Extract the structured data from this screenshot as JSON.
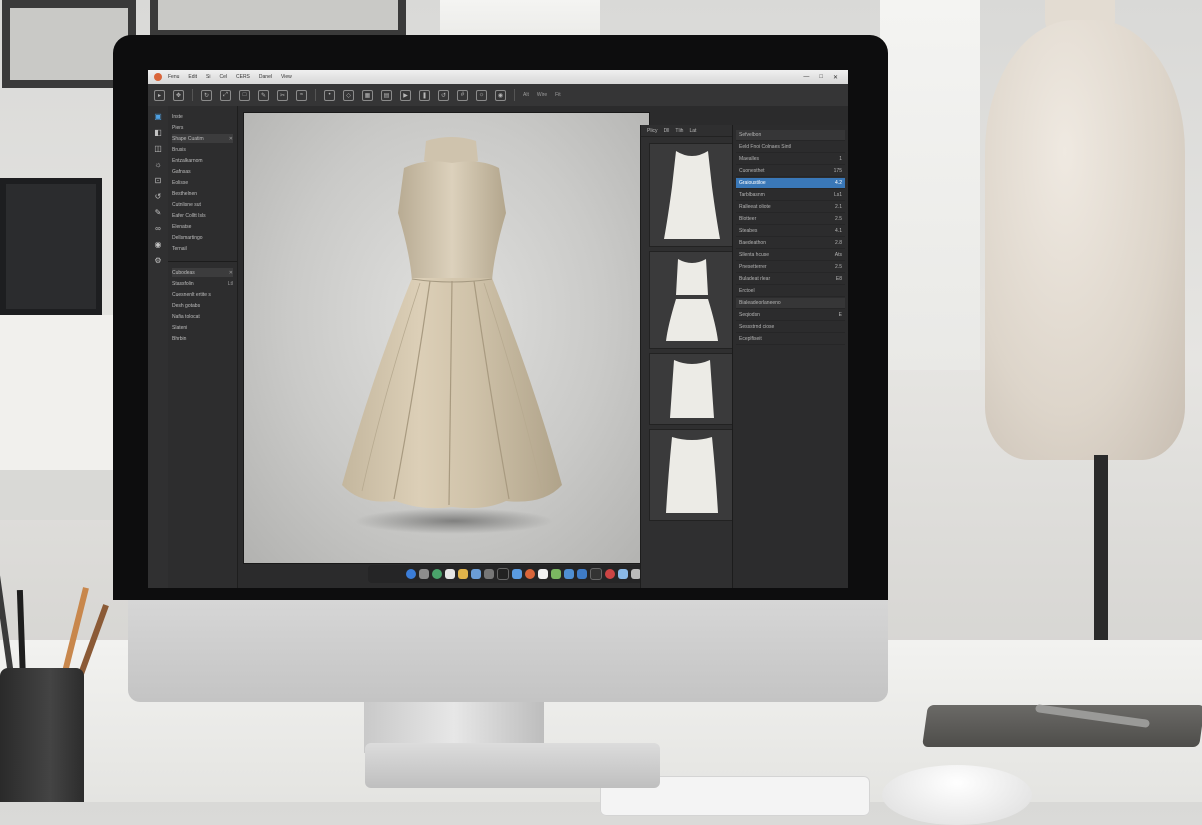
{
  "app": {
    "menu": [
      "Fenu",
      "Edit",
      "Si",
      "Cel",
      "CERS",
      "Danel",
      "View"
    ],
    "window_controls": [
      "—",
      "□",
      "✕"
    ]
  },
  "toolbar": {
    "labels": [
      "Alt",
      "Wire",
      "Fit"
    ]
  },
  "left_panel": {
    "rows": [
      {
        "label": "Inste",
        "meta": ""
      },
      {
        "label": "Piers",
        "meta": ""
      },
      {
        "label": "Shape Cuatim",
        "meta": "✕"
      },
      {
        "label": "Brusis",
        "meta": ""
      },
      {
        "label": "Entzalkarnom",
        "meta": ""
      },
      {
        "label": "Gafnsas",
        "meta": ""
      },
      {
        "label": "Eolisse",
        "meta": ""
      },
      {
        "label": "Besthelnen",
        "meta": ""
      },
      {
        "label": "Cutnlisne sut",
        "meta": ""
      },
      {
        "label": "Eafer Colltt Isls",
        "meta": ""
      },
      {
        "label": "Elenatse",
        "meta": ""
      },
      {
        "label": "Dellsmartingo",
        "meta": ""
      },
      {
        "label": "Ternail",
        "meta": ""
      }
    ],
    "sub_rows": [
      {
        "label": "Cubodeas",
        "meta": "✕"
      },
      {
        "label": "Stassfolin",
        "meta": "Ltl"
      },
      {
        "label": "Cuesnenlt ertite s",
        "meta": ""
      },
      {
        "label": "Desh gotabs",
        "meta": ""
      },
      {
        "label": "Nafia tolocat",
        "meta": ""
      },
      {
        "label": "Slateni",
        "meta": ""
      },
      {
        "label": "Bhrbin",
        "meta": ""
      }
    ]
  },
  "pattern_panel": {
    "tabs": [
      "Plicy",
      "Dll",
      "Tlih",
      "Lat"
    ]
  },
  "layers_panel": {
    "header": "Sefvelbon",
    "title": "Eeld  Fnoi  Colnaes Sintl",
    "rows": [
      {
        "label": "Maealles",
        "meta": "1",
        "type": "normal"
      },
      {
        "label": "Cuonesthet",
        "meta": "175",
        "type": "normal"
      },
      {
        "label": "Graioustiloe",
        "meta": "4.2",
        "type": "selected"
      },
      {
        "label": "Tarblbasnm",
        "meta": "Ls1",
        "type": "normal"
      },
      {
        "label": "Ralleeat oliote",
        "meta": "2.1",
        "type": "normal"
      },
      {
        "label": "Blotteer",
        "meta": "2.5",
        "type": "normal"
      },
      {
        "label": "Steabes",
        "meta": "4.1",
        "type": "normal"
      },
      {
        "label": "Baedeathon",
        "meta": "2.8",
        "type": "normal"
      },
      {
        "label": "Sllenta hcuse",
        "meta": "Ats",
        "type": "normal"
      },
      {
        "label": "Pnesetterrer",
        "meta": "2.5",
        "type": "normal"
      },
      {
        "label": "Buladeat rlear",
        "meta": "E8",
        "type": "normal"
      },
      {
        "label": "Erctoel",
        "meta": "",
        "type": "normal"
      },
      {
        "label": "Bialeadeorlaneeno",
        "meta": "",
        "type": "section"
      },
      {
        "label": "Seqiodsn",
        "meta": "E",
        "type": "normal"
      },
      {
        "label": "Sessstrnd ciose",
        "meta": "",
        "type": "normal"
      },
      {
        "label": "Eceplfiseit",
        "meta": "",
        "type": "normal"
      }
    ]
  },
  "colors": {
    "accent": "#3a78b8",
    "dress": "#d2c6b0",
    "app_bg": "#2b2b2c"
  }
}
